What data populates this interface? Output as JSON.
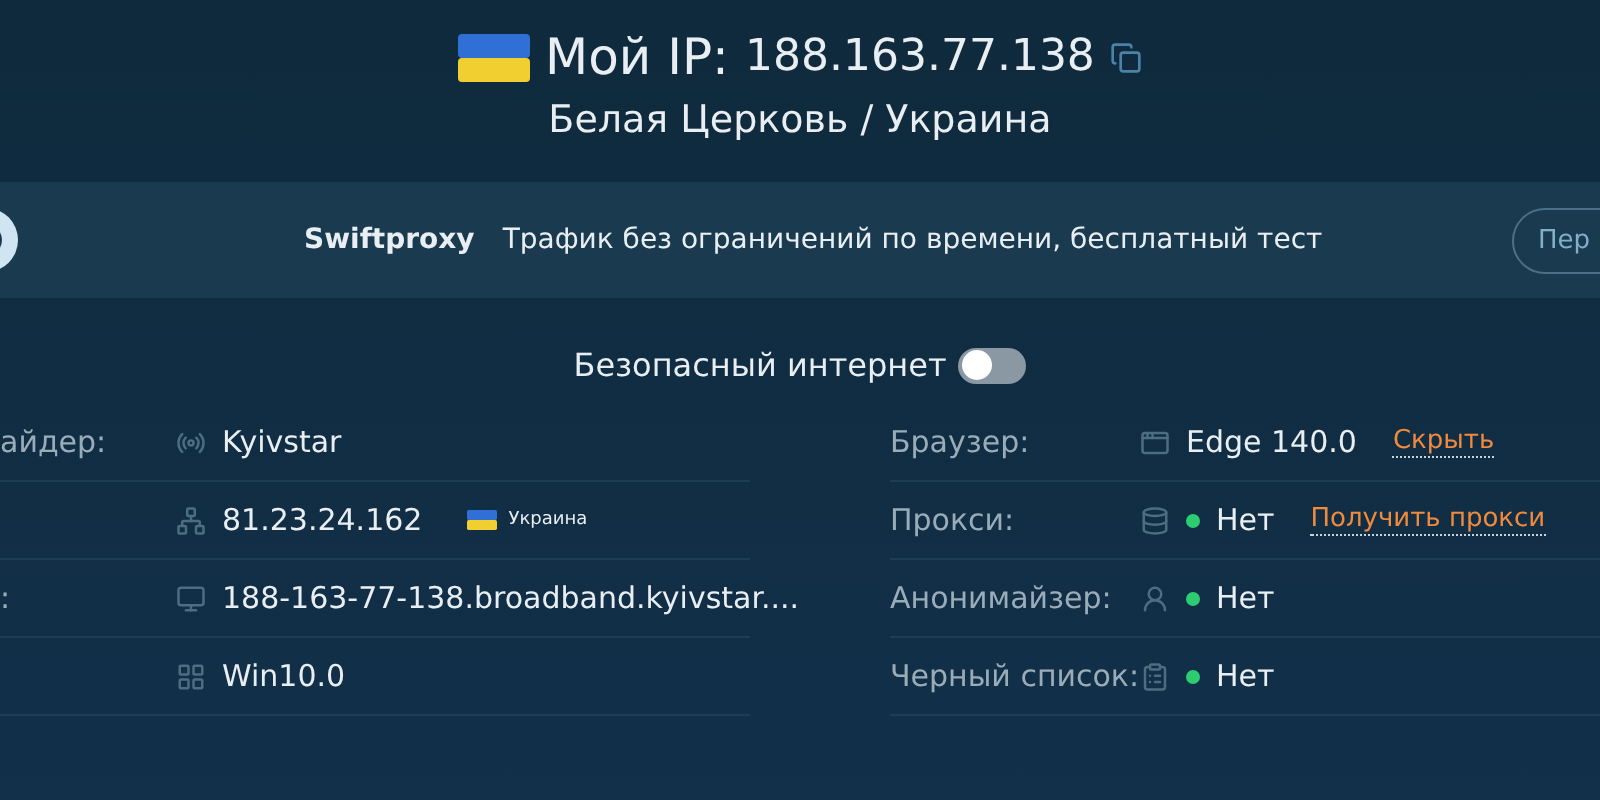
{
  "header": {
    "title": "Мой IP:",
    "ip": "188.163.77.138",
    "location": "Белая Церковь / Украина"
  },
  "banner": {
    "brand": "Swiftproxy",
    "text": "Трафик без ограничений по времени, бесплатный тест",
    "button": "Пер"
  },
  "safe_internet": {
    "label": "Безопасный интернет",
    "on": false
  },
  "left_rows": [
    {
      "label": "айдер:",
      "value": "Kyivstar"
    },
    {
      "value": "81.23.24.162",
      "country": "Украина"
    },
    {
      "label": ":",
      "value": "188-163-77-138.broadband.kyivstar...."
    },
    {
      "value": "Win10.0"
    }
  ],
  "right_rows": [
    {
      "label": "Браузер:",
      "value": "Edge 140.0",
      "dot": false,
      "link": "Скрыть"
    },
    {
      "label": "Прокси:",
      "value": "Нет",
      "dot": true,
      "link": "Получить прокси"
    },
    {
      "label": "Анонимайзер:",
      "value": "Нет",
      "dot": true
    },
    {
      "label": "Черный список:",
      "value": "Нет",
      "dot": true
    }
  ]
}
